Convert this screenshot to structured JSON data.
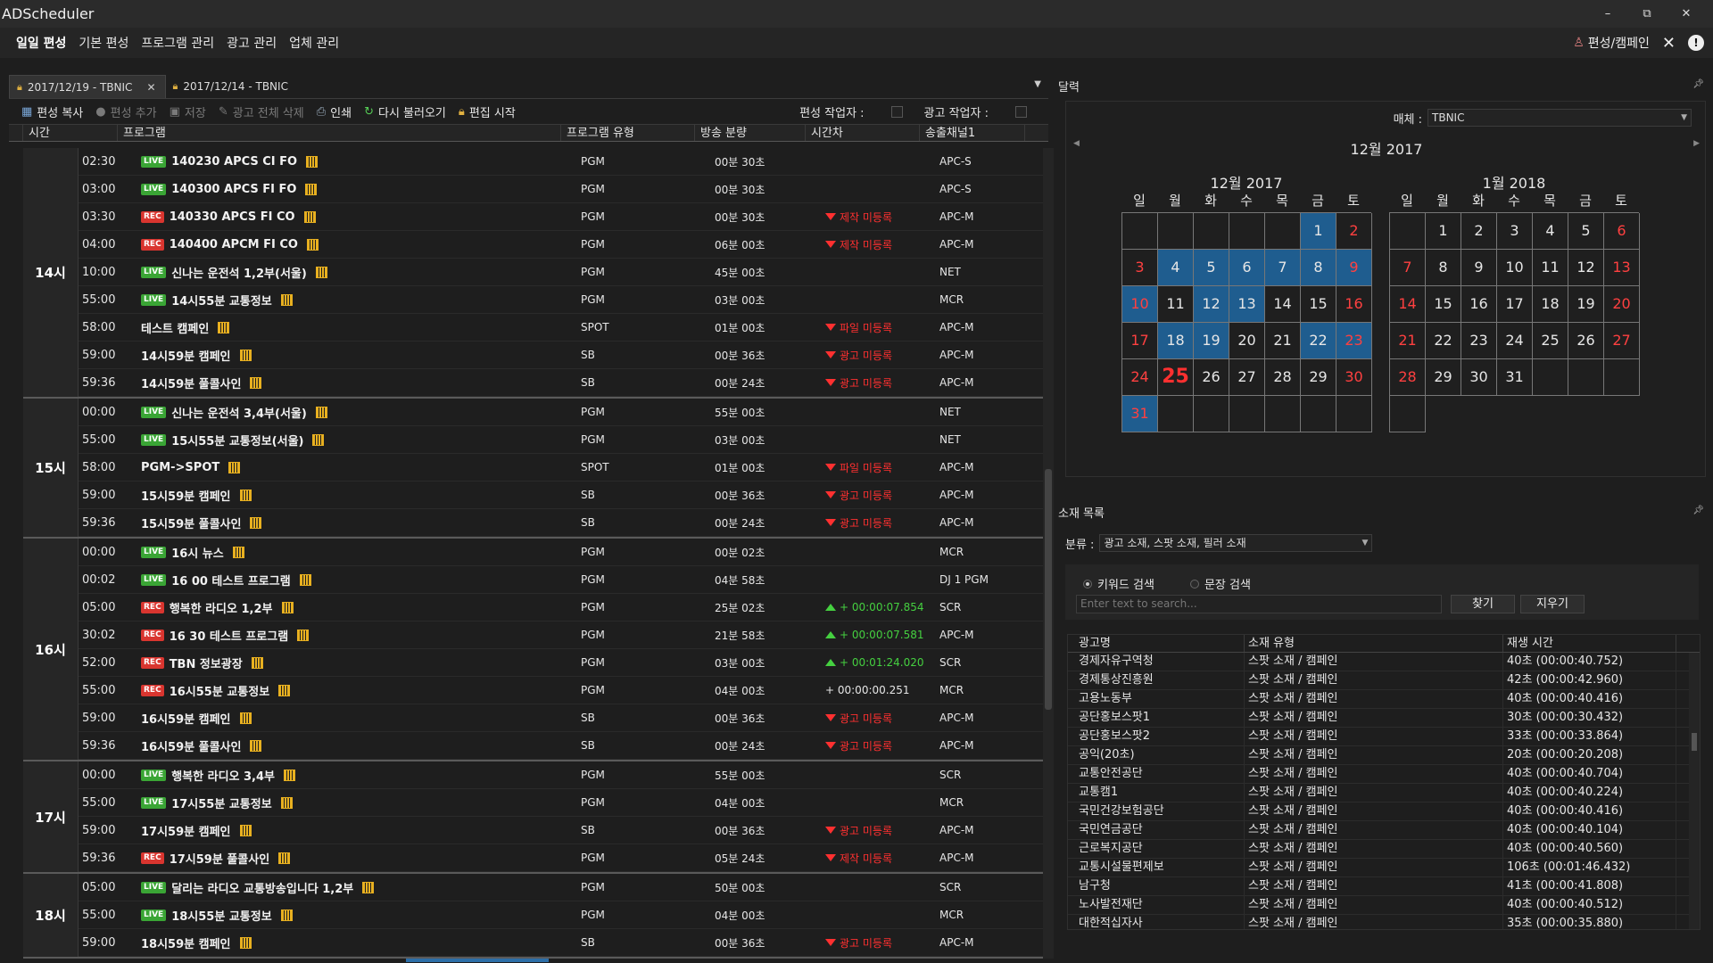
{
  "app_title": "ADScheduler",
  "window_controls": {
    "minimize": "–",
    "restore": "⧉",
    "close": "✕"
  },
  "menu": [
    "일일 편성",
    "기본 편성",
    "프로그램 관리",
    "광고 관리",
    "업체 관리"
  ],
  "menu_right": {
    "campaign_link": "편성/캠페인"
  },
  "tabs": [
    {
      "label": "2017/12/19 - TBNIC",
      "active": true
    },
    {
      "label": "2017/12/14 - TBNIC",
      "active": false
    }
  ],
  "toolbar": {
    "copy": "편성 복사",
    "add": "편성 추가",
    "save": "저장",
    "delete_all_ads": "광고 전체 삭제",
    "print": "인쇄",
    "reload": "다시 불러오기",
    "start_edit": "편집 시작",
    "schedule_worker": "편성 작업자 :",
    "ad_worker": "광고 작업자 :"
  },
  "grid_columns": [
    "시간",
    "프로그램",
    "프로그램 유형",
    "방송 분량",
    "시간차",
    "송출채널1"
  ],
  "schedule": [
    {
      "hour": "14시",
      "rows": [
        {
          "time": "02:30",
          "badge": "LIVE",
          "name": "140230 APCS CI FO",
          "type": "PGM",
          "duration": "00분 30초",
          "diff": "",
          "diff_kind": "",
          "channel": "APC-S"
        },
        {
          "time": "03:00",
          "badge": "LIVE",
          "name": "140300 APCS FI FO",
          "type": "PGM",
          "duration": "00분 30초",
          "diff": "",
          "diff_kind": "",
          "channel": "APC-S"
        },
        {
          "time": "03:30",
          "badge": "REC",
          "name": "140330 APCS FI CO",
          "type": "PGM",
          "duration": "00분 30초",
          "diff": "제작 미등록",
          "diff_kind": "neg",
          "channel": "APC-M"
        },
        {
          "time": "04:00",
          "badge": "REC",
          "name": "140400 APCM FI CO",
          "type": "PGM",
          "duration": "06분 00초",
          "diff": "제작 미등록",
          "diff_kind": "neg",
          "channel": "APC-M"
        },
        {
          "time": "10:00",
          "badge": "LIVE",
          "name": "신나는 운전석 1,2부(서울)",
          "type": "PGM",
          "duration": "45분 00초",
          "diff": "",
          "diff_kind": "",
          "channel": "NET"
        },
        {
          "time": "55:00",
          "badge": "LIVE",
          "name": "14시55분 교통정보",
          "type": "PGM",
          "duration": "03분 00초",
          "diff": "",
          "diff_kind": "",
          "channel": "MCR"
        },
        {
          "time": "58:00",
          "badge": "",
          "name": "테스트 캠페인",
          "type": "SPOT",
          "duration": "01분 00초",
          "diff": "파일 미등록",
          "diff_kind": "neg",
          "channel": "APC-M"
        },
        {
          "time": "59:00",
          "badge": "",
          "name": "14시59분 캠페인",
          "type": "SB",
          "duration": "00분 36초",
          "diff": "광고 미등록",
          "diff_kind": "neg",
          "channel": "APC-M"
        },
        {
          "time": "59:36",
          "badge": "",
          "name": "14시59분 풀콜사인",
          "type": "SB",
          "duration": "00분 24초",
          "diff": "광고 미등록",
          "diff_kind": "neg",
          "channel": "APC-M"
        }
      ]
    },
    {
      "hour": "15시",
      "rows": [
        {
          "time": "00:00",
          "badge": "LIVE",
          "name": "신나는 운전석 3,4부(서울)",
          "type": "PGM",
          "duration": "55분 00초",
          "diff": "",
          "diff_kind": "",
          "channel": "NET"
        },
        {
          "time": "55:00",
          "badge": "LIVE",
          "name": "15시55분 교통정보(서울)",
          "type": "PGM",
          "duration": "03분 00초",
          "diff": "",
          "diff_kind": "",
          "channel": "NET"
        },
        {
          "time": "58:00",
          "badge": "",
          "name": "PGM->SPOT",
          "type": "SPOT",
          "duration": "01분 00초",
          "diff": "파일 미등록",
          "diff_kind": "neg",
          "channel": "APC-M"
        },
        {
          "time": "59:00",
          "badge": "",
          "name": "15시59분 캠페인",
          "type": "SB",
          "duration": "00분 36초",
          "diff": "광고 미등록",
          "diff_kind": "neg",
          "channel": "APC-M"
        },
        {
          "time": "59:36",
          "badge": "",
          "name": "15시59분 풀콜사인",
          "type": "SB",
          "duration": "00분 24초",
          "diff": "광고 미등록",
          "diff_kind": "neg",
          "channel": "APC-M"
        }
      ]
    },
    {
      "hour": "16시",
      "rows": [
        {
          "time": "00:00",
          "badge": "LIVE",
          "name": "16시 뉴스",
          "type": "PGM",
          "duration": "00분 02초",
          "diff": "",
          "diff_kind": "",
          "channel": "MCR"
        },
        {
          "time": "00:02",
          "badge": "LIVE",
          "name": "16 00 테스트 프로그램",
          "type": "PGM",
          "duration": "04분 58초",
          "diff": "",
          "diff_kind": "",
          "channel": "DJ 1 PGM"
        },
        {
          "time": "05:00",
          "badge": "REC",
          "name": "행복한 라디오 1,2부",
          "type": "PGM",
          "duration": "25분 02초",
          "diff": "+ 00:00:07.854",
          "diff_kind": "pos",
          "channel": "SCR"
        },
        {
          "time": "30:02",
          "badge": "REC",
          "name": "16 30 테스트 프로그램",
          "type": "PGM",
          "duration": "21분 58초",
          "diff": "+ 00:00:07.581",
          "diff_kind": "pos",
          "channel": "APC-M"
        },
        {
          "time": "52:00",
          "badge": "REC",
          "name": "TBN 정보광장",
          "type": "PGM",
          "duration": "03분 00초",
          "diff": "+ 00:01:24.020",
          "diff_kind": "pos",
          "channel": "SCR"
        },
        {
          "time": "55:00",
          "badge": "REC",
          "name": "16시55분 교통정보",
          "type": "PGM",
          "duration": "04분 00초",
          "diff": "+ 00:00:00.251",
          "diff_kind": "plain",
          "channel": "MCR"
        },
        {
          "time": "59:00",
          "badge": "",
          "name": "16시59분 캠페인",
          "type": "SB",
          "duration": "00분 36초",
          "diff": "광고 미등록",
          "diff_kind": "neg",
          "channel": "APC-M"
        },
        {
          "time": "59:36",
          "badge": "",
          "name": "16시59분 풀콜사인",
          "type": "SB",
          "duration": "00분 24초",
          "diff": "광고 미등록",
          "diff_kind": "neg",
          "channel": "APC-M"
        }
      ]
    },
    {
      "hour": "17시",
      "rows": [
        {
          "time": "00:00",
          "badge": "LIVE",
          "name": "행복한 라디오 3,4부",
          "type": "PGM",
          "duration": "55분 00초",
          "diff": "",
          "diff_kind": "",
          "channel": "SCR"
        },
        {
          "time": "55:00",
          "badge": "LIVE",
          "name": "17시55분 교통정보",
          "type": "PGM",
          "duration": "04분 00초",
          "diff": "",
          "diff_kind": "",
          "channel": "MCR"
        },
        {
          "time": "59:00",
          "badge": "",
          "name": "17시59분 캠페인",
          "type": "SB",
          "duration": "00분 36초",
          "diff": "광고 미등록",
          "diff_kind": "neg",
          "channel": "APC-M"
        },
        {
          "time": "59:36",
          "badge": "REC",
          "name": "17시59분 풀콜사인",
          "type": "PGM",
          "duration": "05분 24초",
          "diff": "제작 미등록",
          "diff_kind": "neg",
          "channel": "APC-M"
        }
      ]
    },
    {
      "hour": "18시",
      "rows": [
        {
          "time": "05:00",
          "badge": "LIVE",
          "name": "달리는 라디오 교통방송입니다 1,2부",
          "type": "PGM",
          "duration": "50분 00초",
          "diff": "",
          "diff_kind": "",
          "channel": "SCR"
        },
        {
          "time": "55:00",
          "badge": "LIVE",
          "name": "18시55분 교통정보",
          "type": "PGM",
          "duration": "04분 00초",
          "diff": "",
          "diff_kind": "",
          "channel": "MCR"
        },
        {
          "time": "59:00",
          "badge": "",
          "name": "18시59분 캠페인",
          "type": "SB",
          "duration": "00분 36초",
          "diff": "광고 미등록",
          "diff_kind": "neg",
          "channel": "APC-M"
        }
      ]
    }
  ],
  "calendar_panel": {
    "title": "달력",
    "medium_label": "매체 :",
    "medium_value": "TBNIC",
    "nav_title": "12월 2017",
    "dow": [
      "일",
      "월",
      "화",
      "수",
      "목",
      "금",
      "토"
    ],
    "months": [
      {
        "title": "12월 2017",
        "first_dow": 5,
        "days": 31,
        "today": 25,
        "selected": [
          1,
          4,
          5,
          6,
          7,
          8,
          9,
          10,
          12,
          13,
          18,
          19,
          22,
          23,
          31
        ],
        "trail_blank": 6
      },
      {
        "title": "1월 2018",
        "first_dow": 1,
        "days": 31,
        "today": 0,
        "selected": [],
        "trail_blank": 4
      }
    ]
  },
  "materials_panel": {
    "title": "소재 목록",
    "filter_label": "분류 :",
    "filter_value": "광고 소재, 스팟 소재, 필러 소재",
    "radio_keyword": "키워드 검색",
    "radio_sentence": "문장 검색",
    "search_placeholder": "Enter text to search...",
    "find_button": "찾기",
    "clear_button": "지우기",
    "columns": [
      "광고명",
      "소재 유형",
      "재생 시간"
    ],
    "rows": [
      [
        "경제자유구역청",
        "스팟 소재 / 캠페인",
        "40초 (00:00:40.752)"
      ],
      [
        "경제통상진흥원",
        "스팟 소재 / 캠페인",
        "42초 (00:00:42.960)"
      ],
      [
        "고용노동부",
        "스팟 소재 / 캠페인",
        "40초 (00:00:40.416)"
      ],
      [
        "공단홍보스팟1",
        "스팟 소재 / 캠페인",
        "30초 (00:00:30.432)"
      ],
      [
        "공단홍보스팟2",
        "스팟 소재 / 캠페인",
        "33초 (00:00:33.864)"
      ],
      [
        "공익(20초)",
        "스팟 소재 / 캠페인",
        "20초 (00:00:20.208)"
      ],
      [
        "교통안전공단",
        "스팟 소재 / 캠페인",
        "40초 (00:00:40.704)"
      ],
      [
        "교통캠1",
        "스팟 소재 / 캠페인",
        "40초 (00:00:40.224)"
      ],
      [
        "국민건강보험공단",
        "스팟 소재 / 캠페인",
        "40초 (00:00:40.416)"
      ],
      [
        "국민연금공단",
        "스팟 소재 / 캠페인",
        "40초 (00:00:40.104)"
      ],
      [
        "근로복지공단",
        "스팟 소재 / 캠페인",
        "40초 (00:00:40.560)"
      ],
      [
        "교통시설물편제보",
        "스팟 소재 / 캠페인",
        "106초 (00:01:46.432)"
      ],
      [
        "남구청",
        "스팟 소재 / 캠페인",
        "41초 (00:00:41.808)"
      ],
      [
        "노사발전재단",
        "스팟 소재 / 캠페인",
        "40초 (00:00:40.512)"
      ],
      [
        "대한적십자사",
        "스팟 소재 / 캠페인",
        "35초 (00:00:35.880)"
      ]
    ]
  },
  "colors": {
    "selected_day": "#1f5d8f",
    "weekend": "#ff4040",
    "live_badge": "#3aa535",
    "rec_badge": "#d9352f",
    "positive_diff": "#45d040",
    "negative_diff": "#ff3030"
  }
}
